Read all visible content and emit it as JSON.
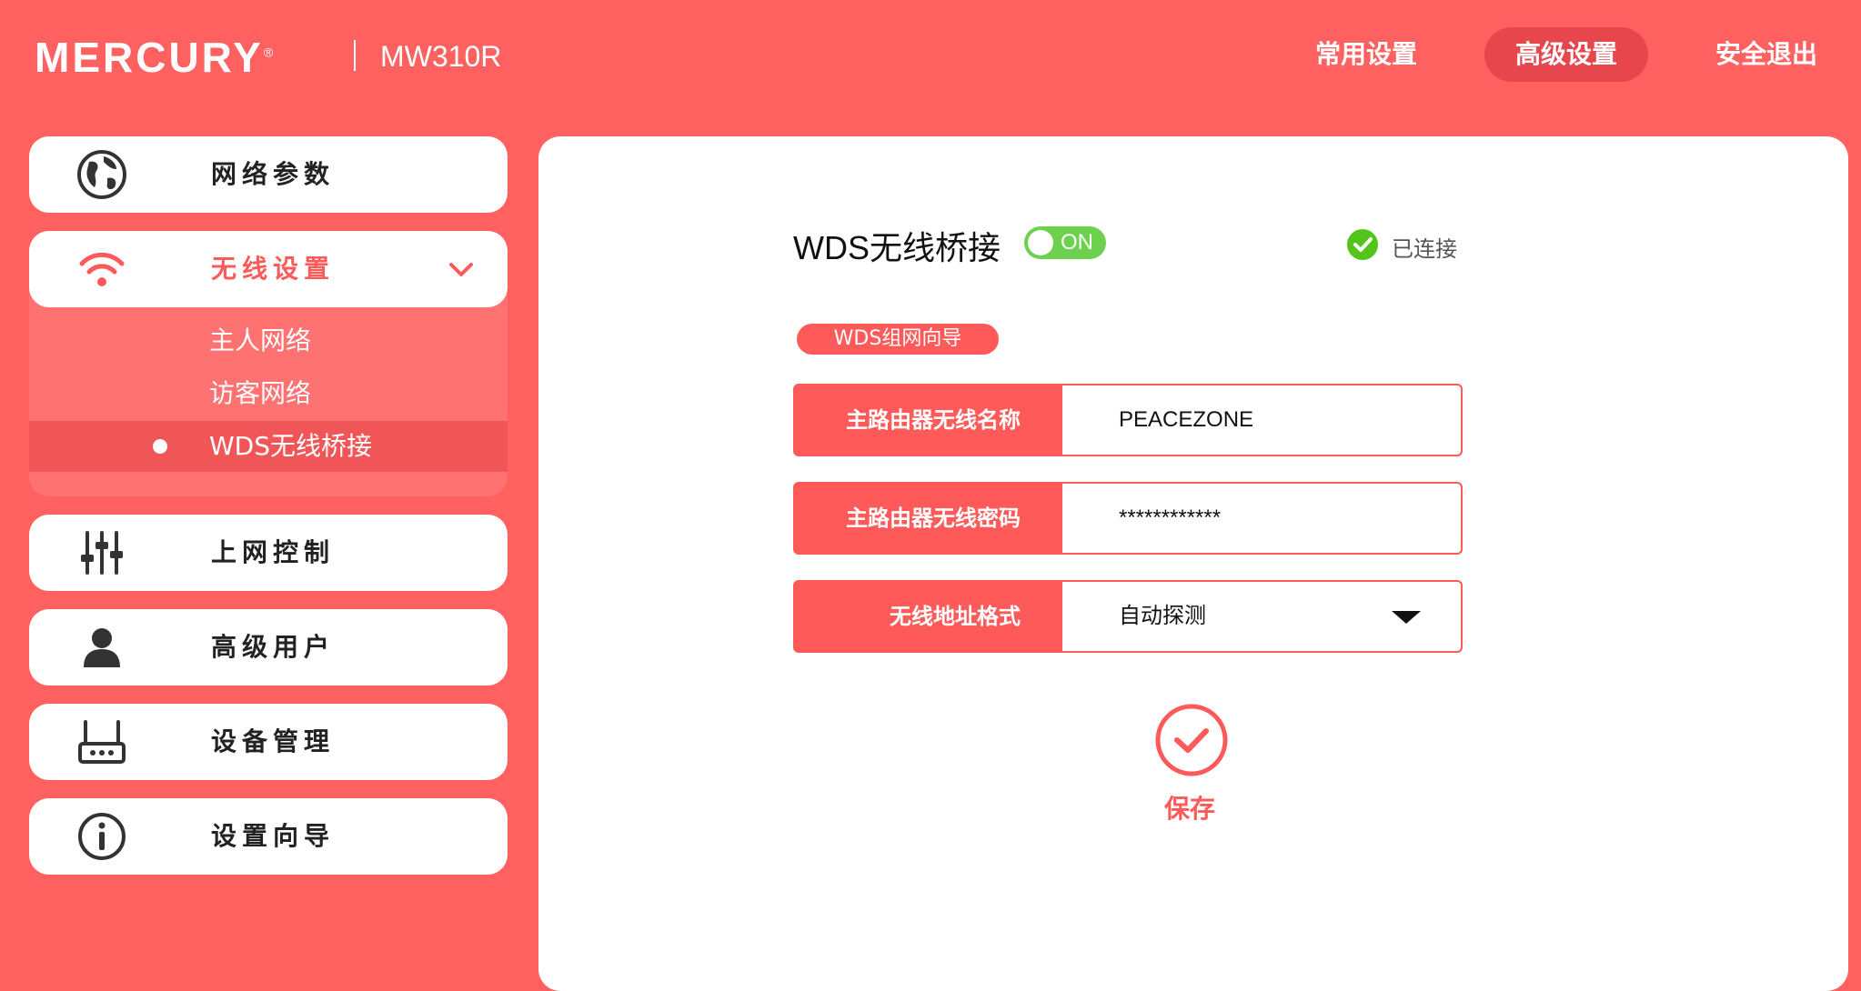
{
  "header": {
    "brand": "MERCURY",
    "brand_mark": "®",
    "model": "MW310R",
    "nav": [
      {
        "label": "常用设置"
      },
      {
        "label": "高级设置"
      },
      {
        "label": "安全退出"
      }
    ]
  },
  "sidebar": {
    "items": [
      {
        "label": "网络参数",
        "icon": "globe-icon"
      },
      {
        "label": "无线设置",
        "icon": "wifi-icon"
      },
      {
        "label": "上网控制",
        "icon": "sliders-icon"
      },
      {
        "label": "高级用户",
        "icon": "user-icon"
      },
      {
        "label": "设备管理",
        "icon": "router-icon"
      },
      {
        "label": "设置向导",
        "icon": "info-icon"
      }
    ],
    "wireless_subitems": [
      {
        "label": "主人网络"
      },
      {
        "label": "访客网络"
      },
      {
        "label": "WDS无线桥接"
      }
    ]
  },
  "main": {
    "title": "WDS无线桥接",
    "toggle": {
      "label": "ON",
      "on": true
    },
    "status": "已连接",
    "guide_button": "WDS组网向导",
    "fields": [
      {
        "label": "主路由器无线名称",
        "value": "PEACEZONE"
      },
      {
        "label": "主路由器无线密码",
        "value": "************"
      },
      {
        "label": "无线地址格式",
        "value": "自动探测"
      }
    ],
    "save_label": "保存"
  },
  "colors": {
    "brand_red": "#ff6060",
    "accent_red": "#ff5a5a",
    "active_nav": "#e8464d",
    "toggle_green": "#6dd04f",
    "status_green": "#52c41a"
  }
}
